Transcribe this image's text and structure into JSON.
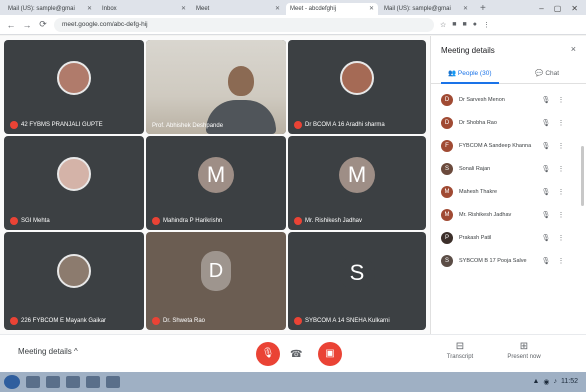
{
  "browser": {
    "tabs": [
      {
        "label": "Mail (US): sample@gmai",
        "active": false
      },
      {
        "label": "Inbox",
        "active": false
      },
      {
        "label": "Meet",
        "active": false
      },
      {
        "label": "Meet - abcdefghij",
        "active": true
      },
      {
        "label": "Mail (US): sample@gmai",
        "active": false
      }
    ],
    "new_tab": "+",
    "url": "meet.google.com/abc-defg-hij"
  },
  "tiles": [
    {
      "name": "42 FYBMS PRANJALI GUPTE",
      "kind": "photo",
      "avatar_color": "#b07b6b"
    },
    {
      "name": "Prof. Abhishek Deshpande",
      "kind": "video"
    },
    {
      "name": "Dr BCOM A 16 Aradhi sharma",
      "kind": "photo",
      "avatar_color": "#a56a55"
    },
    {
      "name": "SGI Mehta",
      "kind": "photo",
      "avatar_color": "#d4b3a8"
    },
    {
      "name": "Mahindra P Harikrishn",
      "kind": "letter",
      "letter": "M",
      "avatar_color": "#9e8e86"
    },
    {
      "name": "Mr. Rishikesh Jadhav",
      "kind": "letter",
      "letter": "M",
      "avatar_color": "#9e8e86"
    },
    {
      "name": "226 FYBCOM E Mayank Gaikar",
      "kind": "photo",
      "avatar_color": "#8c7b6e"
    },
    {
      "name": "Dr. Shweta Rao",
      "kind": "tinted",
      "letter": "D",
      "avatar_color": "#c9a98f"
    },
    {
      "name": "SYBCOM A 14 SNEHA Kulkarni",
      "kind": "letter",
      "letter": "S",
      "avatar_color": "#3c4043"
    }
  ],
  "bottom": {
    "meeting_details": "Meeting details",
    "chevron": "^",
    "mic_icon": "mic-off",
    "hangup_icon": "hangup",
    "cam_icon": "cam-off",
    "tool1": "Transcript",
    "tool2": "Present now"
  },
  "panel": {
    "title": "Meeting details",
    "close": "×",
    "tab_people": "People (30)",
    "tab_chat": "Chat",
    "participants": [
      {
        "name": "Dr Sarvesh Menon",
        "initial": "D",
        "color": "#a04a33"
      },
      {
        "name": "Dr Shobha Rao",
        "initial": "D",
        "color": "#a04a33"
      },
      {
        "name": "FYBCOM A Sandeep Khanna",
        "initial": "F",
        "color": "#a04a33"
      },
      {
        "name": "Sonali Rajan",
        "initial": "S",
        "color": "#6b4a3c"
      },
      {
        "name": "Mahesh Thakre",
        "initial": "M",
        "color": "#a04a33"
      },
      {
        "name": "Mr. Rishikesh Jadhav",
        "initial": "M",
        "color": "#a04a33"
      },
      {
        "name": "Prakash Patil",
        "initial": "P",
        "color": "#3c2f2a"
      },
      {
        "name": "SYBCOM B 17 Pooja Salve",
        "initial": "S",
        "color": "#5b4d46"
      }
    ]
  },
  "taskbar": {
    "tray_time": "11:52"
  }
}
